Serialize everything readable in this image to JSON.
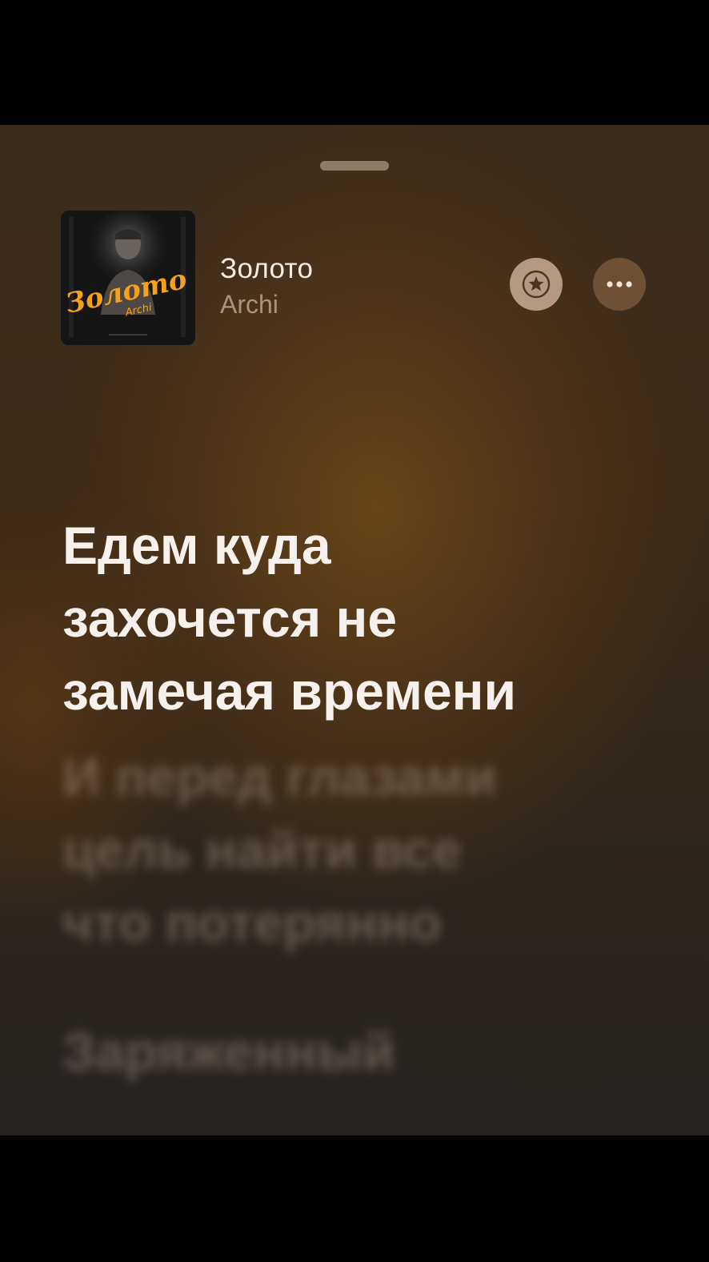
{
  "track": {
    "title": "Золото",
    "artist": "Archi",
    "artwork_text": "Золото",
    "artwork_subtext": "Archi"
  },
  "actions": {
    "favorite_icon": "star-icon",
    "more_icon": "ellipsis-icon"
  },
  "lyrics": {
    "active": [
      "Едем куда",
      "захочется не",
      "замечая времени"
    ],
    "next": [
      "И перед глазами",
      "цель найти все",
      "что потерянно"
    ],
    "following": [
      "Заряженный"
    ]
  },
  "colors": {
    "accent_orange": "#f5a21a",
    "favorite_button": "#b49a82",
    "more_button": "#6e5035"
  }
}
